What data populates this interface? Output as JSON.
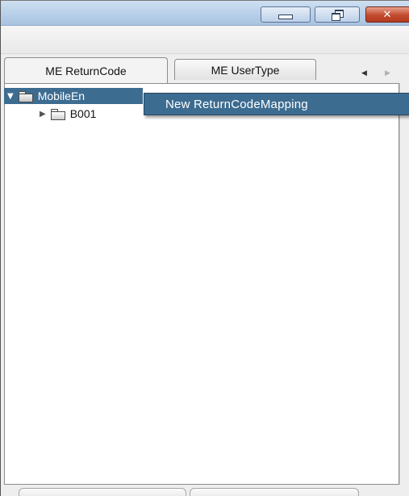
{
  "window": {
    "controls": {
      "minimize_icon": "minimize-icon",
      "restore_icon": "restore-icon",
      "close_icon": "close-icon",
      "close_glyph": "✕"
    }
  },
  "tabs": [
    {
      "label": "ME ReturnCode",
      "active": true
    },
    {
      "label": "ME UserType",
      "active": false
    }
  ],
  "tab_scroll": {
    "left_glyph": "◀",
    "right_glyph": "▶"
  },
  "tree": {
    "root": {
      "label": "MobileEn",
      "expander": "▼",
      "selected": true
    },
    "children": [
      {
        "label": "B001",
        "expander": "▶"
      }
    ]
  },
  "context_menu": {
    "items": [
      {
        "label": "New  ReturnCodeMapping"
      }
    ]
  },
  "colors": {
    "selection": "#3d6c91",
    "close_button": "#c24a2f",
    "titlebar": "#b7cfe8"
  }
}
